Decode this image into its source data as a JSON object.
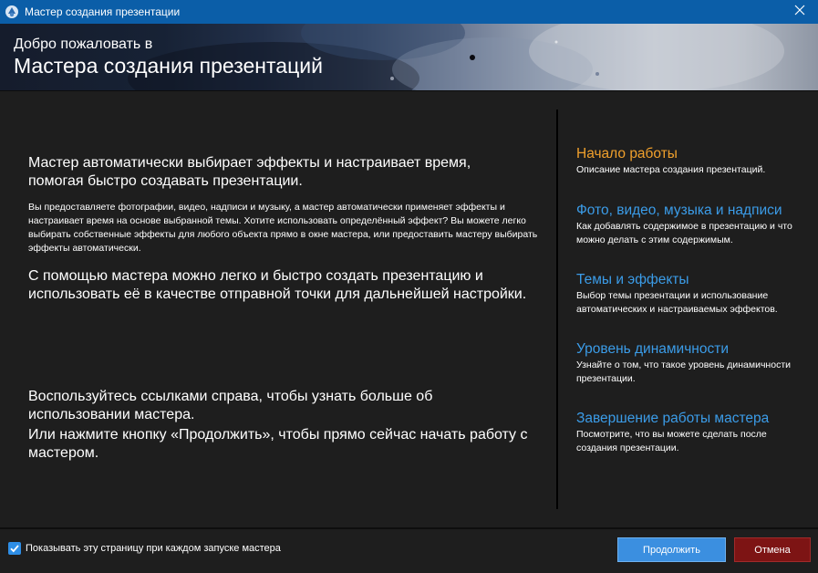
{
  "window": {
    "title": "Мастер создания презентации",
    "close_icon": "close-icon",
    "app_icon": "app-icon"
  },
  "banner": {
    "subtitle": "Добро пожаловать в",
    "title": "Мастера создания презентаций"
  },
  "main": {
    "intro_lead": "Мастер автоматически выбирает эффекты и настраивает время, помогая быстро создавать презентации.",
    "intro_detail": "Вы предоставляете фотографии, видео, надписи и музыку, а мастер автоматически применяет эффекты и настраивает время на основе выбранной темы. Хотите использовать определённый эффект? Вы можете легко выбирать собственные эффекты для любого объекта прямо в окне мастера, или предоставить мастеру выбирать эффекты автоматически.",
    "summary": "С помощью мастера можно легко и быстро создать презентацию и использовать её в качестве отправной точки для дальнейшей настройки.",
    "hint_links": "Воспользуйтесь ссылками справа, чтобы узнать больше об использовании мастера.",
    "hint_continue": "Или нажмите кнопку «Продолжить», чтобы прямо сейчас начать работу с мастером."
  },
  "nav": [
    {
      "title": "Начало работы",
      "desc": "Описание мастера создания презентаций.",
      "active": true
    },
    {
      "title": "Фото, видео, музыка и надписи",
      "desc": "Как добавлять содержимое в презентацию и что можно делать с этим содержимым.",
      "active": false
    },
    {
      "title": "Темы и эффекты",
      "desc": "Выбор темы презентации и использование автоматических и настраиваемых эффектов.",
      "active": false
    },
    {
      "title": "Уровень динамичности",
      "desc": "Узнайте о том, что такое уровень динамичности презентации.",
      "active": false
    },
    {
      "title": "Завершение работы мастера",
      "desc": "Посмотрите, что вы можете сделать после создания презентации.",
      "active": false
    }
  ],
  "footer": {
    "show_checkbox_label": "Показывать эту страницу при каждом запуске мастера",
    "show_checkbox_checked": true,
    "continue_label": "Продолжить",
    "cancel_label": "Отмена"
  },
  "colors": {
    "titlebar": "#0b5ea8",
    "background": "#1e1e1e",
    "link": "#3b9ce8",
    "active_link": "#f0a02c",
    "continue_button": "#3b8fe0",
    "cancel_button": "#7d1414"
  }
}
